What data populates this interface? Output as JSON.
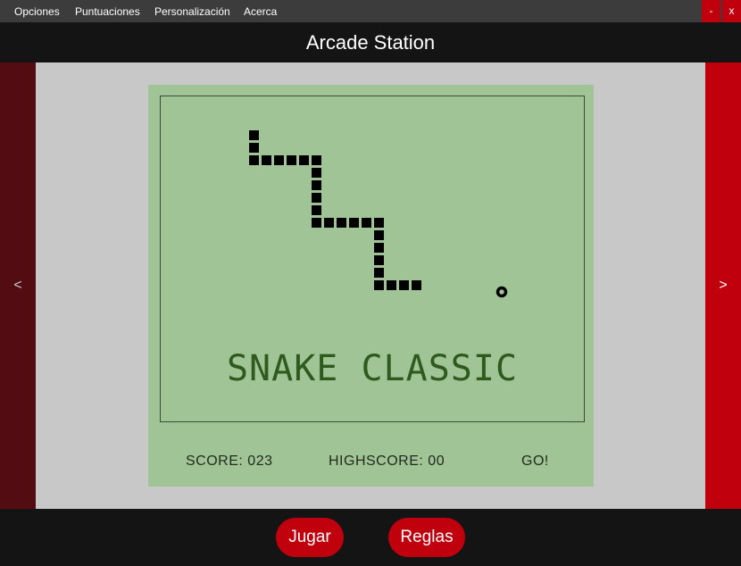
{
  "menu": [
    "Opciones",
    "Puntuaciones",
    "Personalización",
    "Acerca"
  ],
  "window_controls": {
    "minimize": "-",
    "close": "x"
  },
  "app_title": "Arcade Station",
  "nav": {
    "prev": "<",
    "next": ">"
  },
  "game": {
    "title": "SNAKE CLASSIC",
    "score_label": "SCORE: 023",
    "highscore_label": "HIGHSCORE: 00",
    "go_label": "GO!"
  },
  "buttons": {
    "play": "Jugar",
    "rules": "Reglas"
  },
  "colors": {
    "accent": "#c0000c",
    "accent_dark": "#520c12",
    "screen_bg": "#a0c496",
    "snake": "#000000",
    "title_text": "#2e5a1e"
  }
}
